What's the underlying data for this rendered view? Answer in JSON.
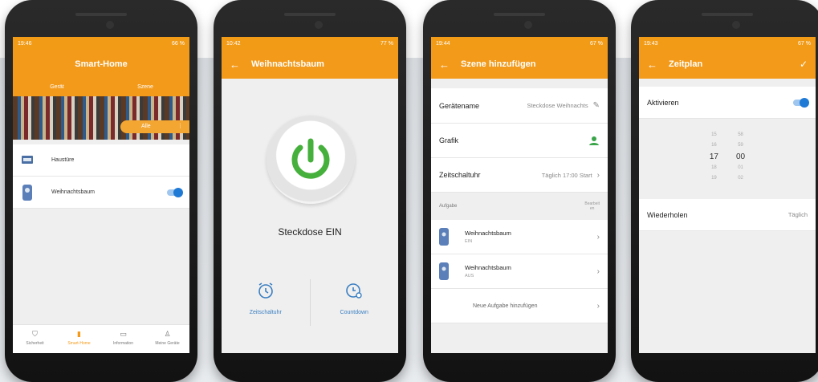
{
  "phone1": {
    "status": {
      "time": "19:46",
      "battery": "66 %"
    },
    "title": "Smart-Home",
    "tabs": [
      "Gerät",
      "Szene"
    ],
    "banner_button": "Alle",
    "devices": [
      {
        "name": "Haustüre",
        "icon": "door-sensor-icon"
      },
      {
        "name": "Weihnachtsbaum",
        "icon": "smart-plug-icon",
        "toggle": "on"
      }
    ],
    "nav": [
      {
        "label": "Sicherheit",
        "icon": "shield-icon"
      },
      {
        "label": "Smart-Home",
        "icon": "home-icon",
        "active": true
      },
      {
        "label": "Information",
        "icon": "message-icon"
      },
      {
        "label": "Meine Geräte",
        "icon": "user-icon"
      }
    ]
  },
  "phone2": {
    "status": {
      "time": "10:42",
      "battery": "77 %"
    },
    "title": "Weihnachtsbaum",
    "state_label": "Steckdose EIN",
    "buttons": [
      {
        "label": "Zeitschaltuhr",
        "icon": "alarm-clock-icon"
      },
      {
        "label": "Countdown",
        "icon": "countdown-clock-icon"
      }
    ]
  },
  "phone3": {
    "status": {
      "time": "19:44",
      "battery": "67 %"
    },
    "title": "Szene hinzufügen",
    "rows": [
      {
        "label": "Gerätename",
        "value": "Steckdose Weihnachts"
      },
      {
        "label": "Grafik",
        "value": ""
      },
      {
        "label": "Zeitschaltuhr",
        "value": "Täglich 17:00 Start"
      }
    ],
    "section": "Aufgabe",
    "edit_label": [
      "Bearbeit",
      "en"
    ],
    "tasks": [
      {
        "name": "Weihnachtsbaum",
        "state": "EIN"
      },
      {
        "name": "Weihnachtsbaum",
        "state": "AUS"
      }
    ],
    "add_task": "Neue Aufgabe hinzufügen"
  },
  "phone4": {
    "status": {
      "time": "19:43",
      "battery": "67 %"
    },
    "title": "Zeitplan",
    "activate": "Aktivieren",
    "picker": {
      "hours": [
        "15",
        "16",
        "17",
        "18",
        "19"
      ],
      "minutes": [
        "58",
        "59",
        "00",
        "01",
        "02"
      ]
    },
    "repeat_label": "Wiederholen",
    "repeat_value": "Täglich"
  },
  "colors": {
    "accent": "#f39a1a",
    "toggle": "#1f7ad6",
    "link": "#3a7fc2",
    "power": "#46b03c"
  }
}
